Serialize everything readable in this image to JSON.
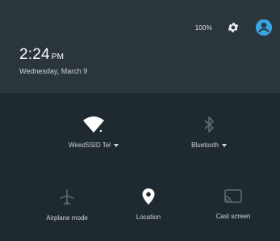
{
  "status": {
    "battery": "100%",
    "settings_icon": "gear-icon",
    "account_icon": "account-icon",
    "accent": "#3aa3e3"
  },
  "header": {
    "time": "2:24",
    "ampm": "PM",
    "date": "Wednesday, March 9"
  },
  "tiles": {
    "wifi": {
      "label": "WiredSSID Tel",
      "icon": "wifi-icon"
    },
    "bluetooth": {
      "label": "Bluetooth",
      "icon": "bluetooth-icon"
    },
    "airplane": {
      "label": "Airplane mode",
      "icon": "airplane-icon"
    },
    "location": {
      "label": "Location",
      "icon": "location-icon"
    },
    "cast": {
      "label": "Cast screen",
      "icon": "cast-icon"
    }
  }
}
